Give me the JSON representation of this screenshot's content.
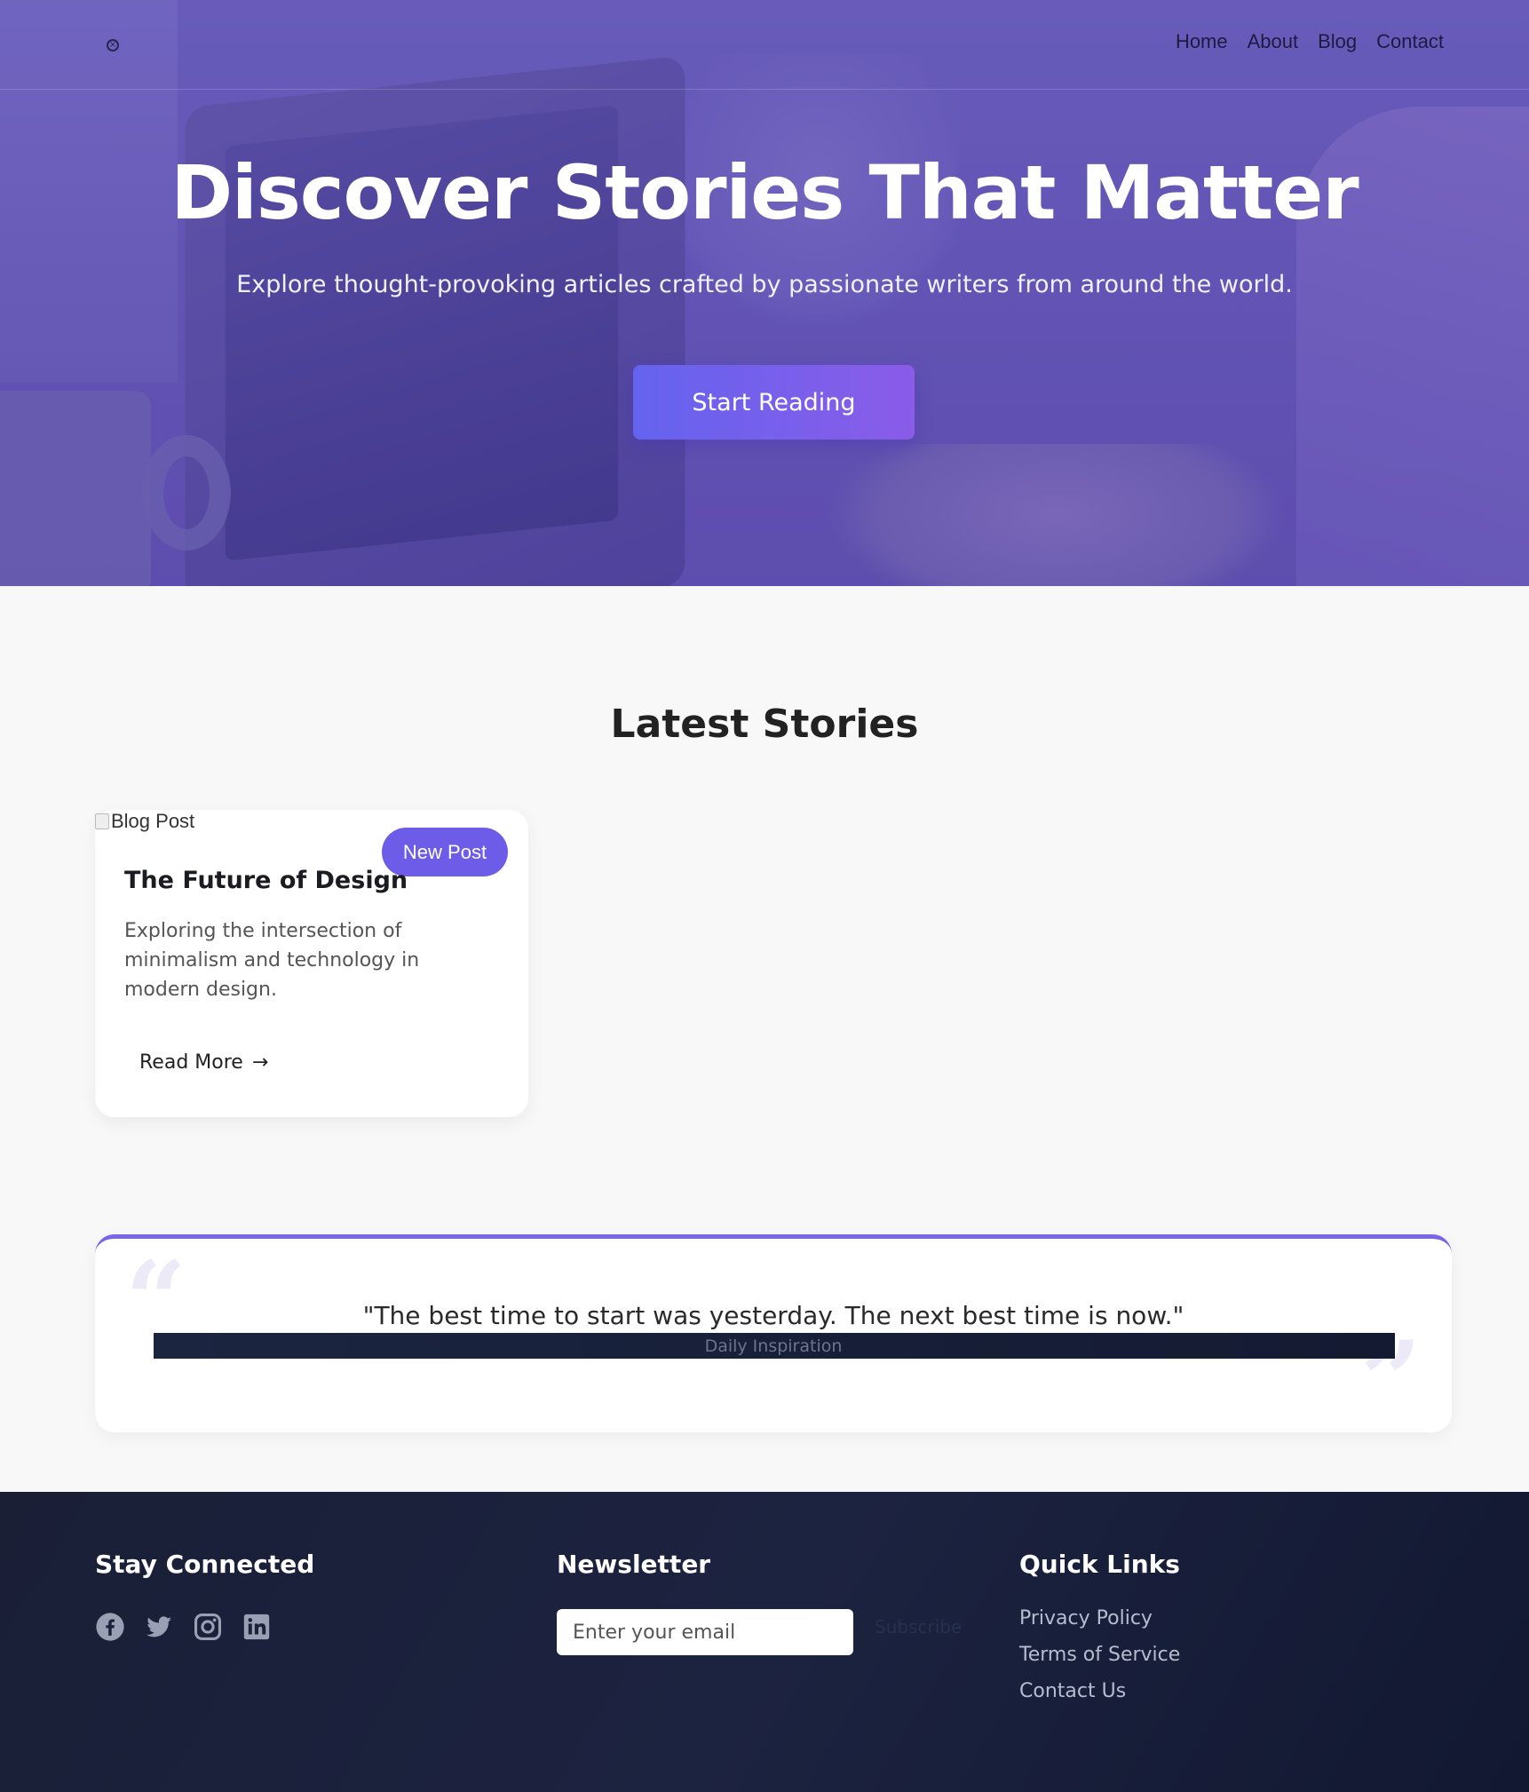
{
  "nav": {
    "logo_icon": "broken-image-icon",
    "links": [
      "Home",
      "About",
      "Blog",
      "Contact"
    ]
  },
  "hero": {
    "title": "Discover Stories That Matter",
    "subtitle": "Explore thought-provoking articles crafted by passionate writers from around the world.",
    "cta_label": "Start Reading"
  },
  "latest": {
    "title": "Latest Stories",
    "cards": [
      {
        "image_alt": "Blog Post",
        "badge": "New Post",
        "title": "The Future of Design",
        "excerpt": "Exploring the intersection of minimalism and technology in modern design.",
        "read_more": "Read More",
        "arrow": "→"
      }
    ]
  },
  "quote": {
    "open_mark": "“",
    "close_mark": "”",
    "text": "\"The best time to start was yesterday. The next best time is now.\"",
    "source": "Daily Inspiration"
  },
  "footer": {
    "social": {
      "title": "Stay Connected",
      "icons": [
        "facebook-icon",
        "twitter-icon",
        "instagram-icon",
        "linkedin-icon"
      ]
    },
    "newsletter": {
      "title": "Newsletter",
      "placeholder": "Enter your email",
      "button_label": "Subscribe"
    },
    "quick_links": {
      "title": "Quick Links",
      "links": [
        "Privacy Policy",
        "Terms of Service",
        "Contact Us"
      ]
    }
  },
  "colors": {
    "accent": "#6d5ce8",
    "footer_bg": "#1a1f36",
    "hero_overlay": "#6a5fb8"
  }
}
